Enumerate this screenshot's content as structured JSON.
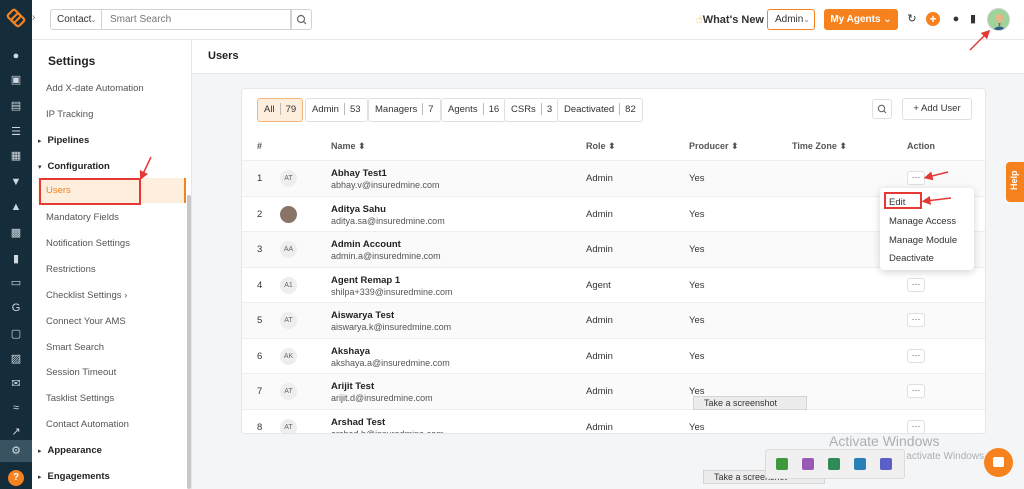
{
  "topbar": {
    "context_select": "Contact",
    "search_placeholder": "Smart Search",
    "whats_new": "What's New",
    "role_select": "Admin",
    "my_agents": "My Agents"
  },
  "settings": {
    "title": "Settings",
    "items": [
      {
        "label": "Add X-date Automation"
      },
      {
        "label": "IP Tracking"
      },
      {
        "label": "Pipelines"
      },
      {
        "label": "Configuration"
      },
      {
        "label": "Users"
      },
      {
        "label": "Mandatory Fields"
      },
      {
        "label": "Notification Settings"
      },
      {
        "label": "Restrictions"
      },
      {
        "label": "Checklist Settings"
      },
      {
        "label": "Connect Your AMS"
      },
      {
        "label": "Smart Search"
      },
      {
        "label": "Session Timeout"
      },
      {
        "label": "Tasklist Settings"
      },
      {
        "label": "Contact Automation"
      },
      {
        "label": "Appearance"
      },
      {
        "label": "Engagements"
      }
    ]
  },
  "page": {
    "title": "Users"
  },
  "filters": [
    {
      "label": "All",
      "count": "79"
    },
    {
      "label": "Admin",
      "count": "53"
    },
    {
      "label": "Managers",
      "count": "7"
    },
    {
      "label": "Agents",
      "count": "16"
    },
    {
      "label": "CSRs",
      "count": "3"
    },
    {
      "label": "Deactivated",
      "count": "82"
    }
  ],
  "add_user": "+ Add User",
  "table": {
    "headers": [
      "#",
      "Name ⬍",
      "Role ⬍",
      "Producer ⬍",
      "Time Zone ⬍",
      "Action"
    ],
    "rows": [
      {
        "num": "1",
        "initials": "AT",
        "name": "Abhay Test1",
        "email": "abhay.v@insuredmine.com",
        "role": "Admin",
        "producer": "Yes"
      },
      {
        "num": "2",
        "initials": "",
        "name": "Aditya Sahu",
        "email": "aditya.sa@insuredmine.com",
        "role": "Admin",
        "producer": "Yes"
      },
      {
        "num": "3",
        "initials": "AA",
        "name": "Admin Account",
        "email": "admin.a@insuredmine.com",
        "role": "Admin",
        "producer": "Yes"
      },
      {
        "num": "4",
        "initials": "A1",
        "name": "Agent Remap 1",
        "email": "shilpa+339@insuredmine.com",
        "role": "Agent",
        "producer": "Yes"
      },
      {
        "num": "5",
        "initials": "AT",
        "name": "Aiswarya Test",
        "email": "aiswarya.k@insuredmine.com",
        "role": "Admin",
        "producer": "Yes"
      },
      {
        "num": "6",
        "initials": "AK",
        "name": "Akshaya",
        "email": "akshaya.a@insuredmine.com",
        "role": "Admin",
        "producer": "Yes"
      },
      {
        "num": "7",
        "initials": "AT",
        "name": "Arijit Test",
        "email": "arijit.d@insuredmine.com",
        "role": "Admin",
        "producer": "Yes"
      },
      {
        "num": "8",
        "initials": "AT",
        "name": "Arshad Test",
        "email": "arshad.h@insuredmine.com",
        "role": "Admin",
        "producer": "Yes"
      }
    ]
  },
  "action_menu": [
    "Edit",
    "Manage Access",
    "Manage Module",
    "Deactivate"
  ],
  "help_tab": "Help",
  "tooltips": [
    "Take a screenshot",
    "Take a screenshot"
  ],
  "watermark": {
    "line1": "Activate Windows",
    "line2": "Go to Settings to activate Windows."
  },
  "colors": {
    "accent": "#f5821f",
    "rail": "#152c3a",
    "annotation": "#e53935"
  }
}
